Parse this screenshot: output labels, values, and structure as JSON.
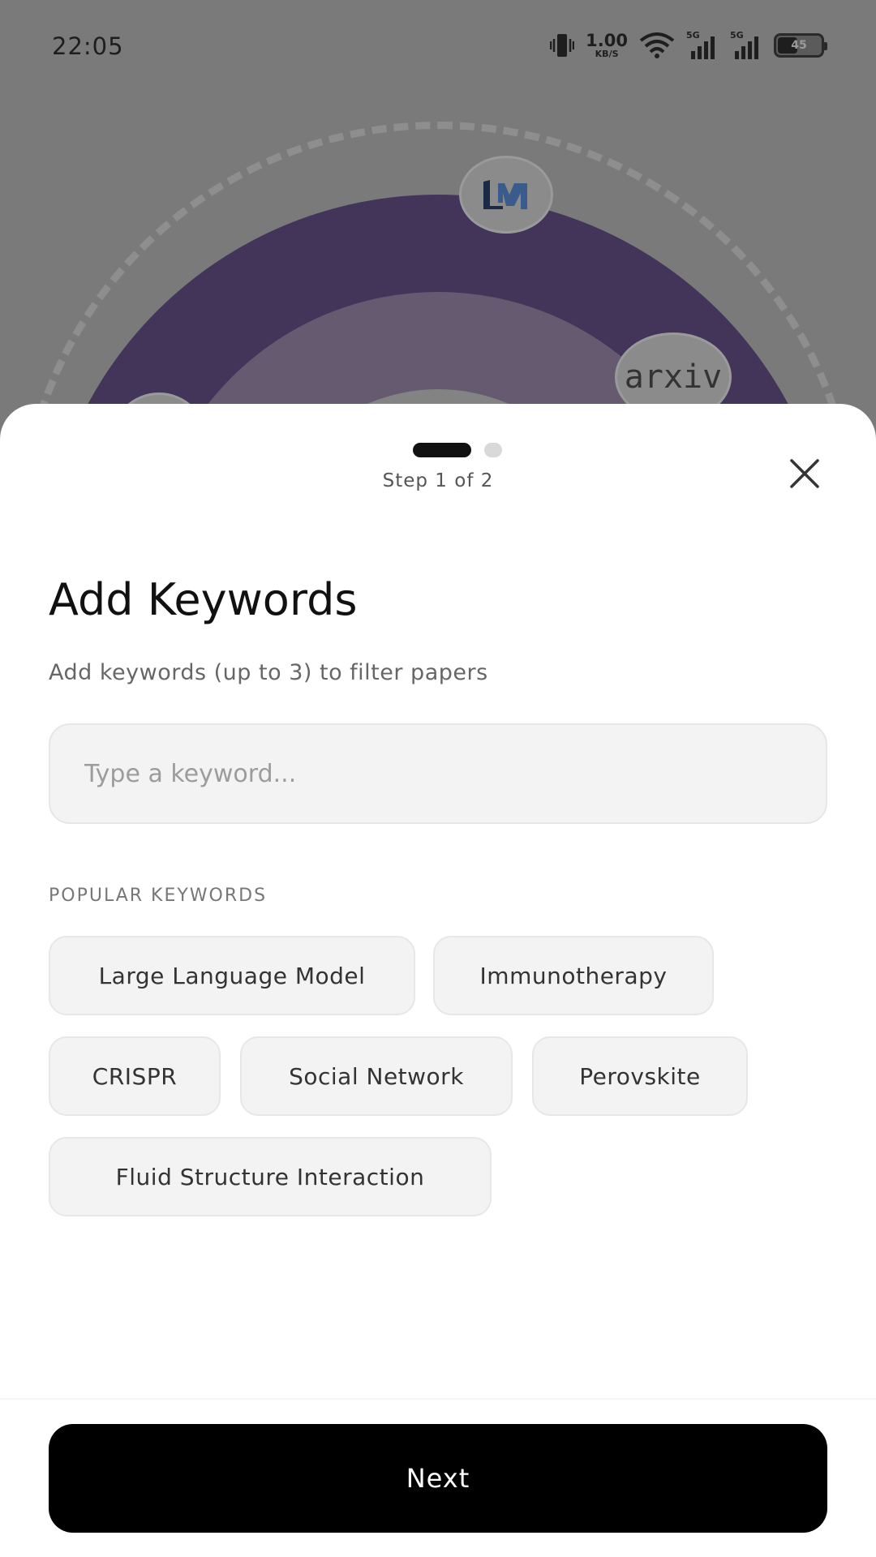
{
  "status_bar": {
    "time": "22:05",
    "net_speed_value": "1.00",
    "net_speed_unit": "KB/S",
    "signal_1_label": "5G",
    "signal_2_label": "5G",
    "battery_level": "45"
  },
  "background": {
    "badges": [
      {
        "name": "lm-logo",
        "text": "LM"
      },
      {
        "name": "arxiv-logo",
        "text": "arxiv"
      }
    ],
    "colors": {
      "outer_ring": "#433459",
      "mid_ring": "#665a70"
    }
  },
  "sheet": {
    "step_label": "Step 1 of 2",
    "current_step": 1,
    "total_steps": 2,
    "title": "Add Keywords",
    "subtitle": "Add keywords (up to 3) to filter papers",
    "input": {
      "placeholder": "Type a keyword...",
      "value": ""
    },
    "popular_label": "POPULAR KEYWORDS",
    "chips": [
      "Large Language Model",
      "Immunotherapy",
      "CRISPR",
      "Social Network",
      "Perovskite",
      "Fluid Structure Interaction"
    ],
    "next_label": "Next"
  },
  "colors": {
    "primary_button": "#000000",
    "chip_bg": "#f3f3f3"
  }
}
